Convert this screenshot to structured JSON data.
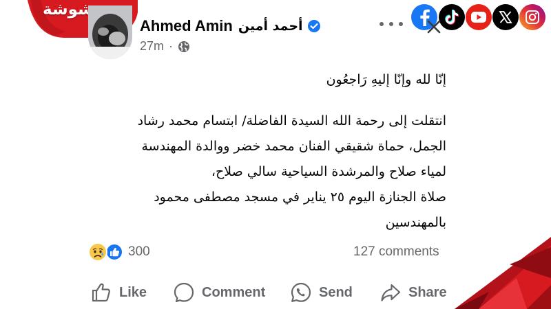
{
  "brand": {
    "logo_text": "وشوشة"
  },
  "post": {
    "author_name": "Ahmed Amin",
    "author_name_ar": "أحمد أمين",
    "timestamp": "27m",
    "meta_separator": "·",
    "body_lines": [
      "إنّا لله وإنّا إليهِ رَاجعُون",
      "انتقلت إلى رحمة الله السيدة الفاضلة/ ابتسام محمد رشاد",
      "الجمل، حماة شقيقي الفنان محمد خضر ووالدة المهندسة",
      "لمياء صلاح والمرشدة السياحية سالي صلاح،",
      "صلاة الجنازة اليوم ٢٥ يناير في مسجد مصطفى محمود",
      "بالمهندسين"
    ]
  },
  "stats": {
    "reaction_count": "300",
    "comments_count": "127 comments",
    "reaction_types": [
      "sad",
      "like"
    ]
  },
  "actions": {
    "like_label": "Like",
    "comment_label": "Comment",
    "send_label": "Send",
    "share_label": "Share"
  },
  "social_icons": [
    "facebook-icon",
    "tiktok-icon",
    "youtube-icon",
    "x-icon",
    "instagram-icon"
  ],
  "colors": {
    "brand_red": "#d71920",
    "dark_red": "#9e0f14",
    "facebook_blue": "#1877f2",
    "youtube_red": "#ff0000",
    "verified_blue": "#1877f2",
    "meta_gray": "#65676b",
    "text": "#050505"
  }
}
